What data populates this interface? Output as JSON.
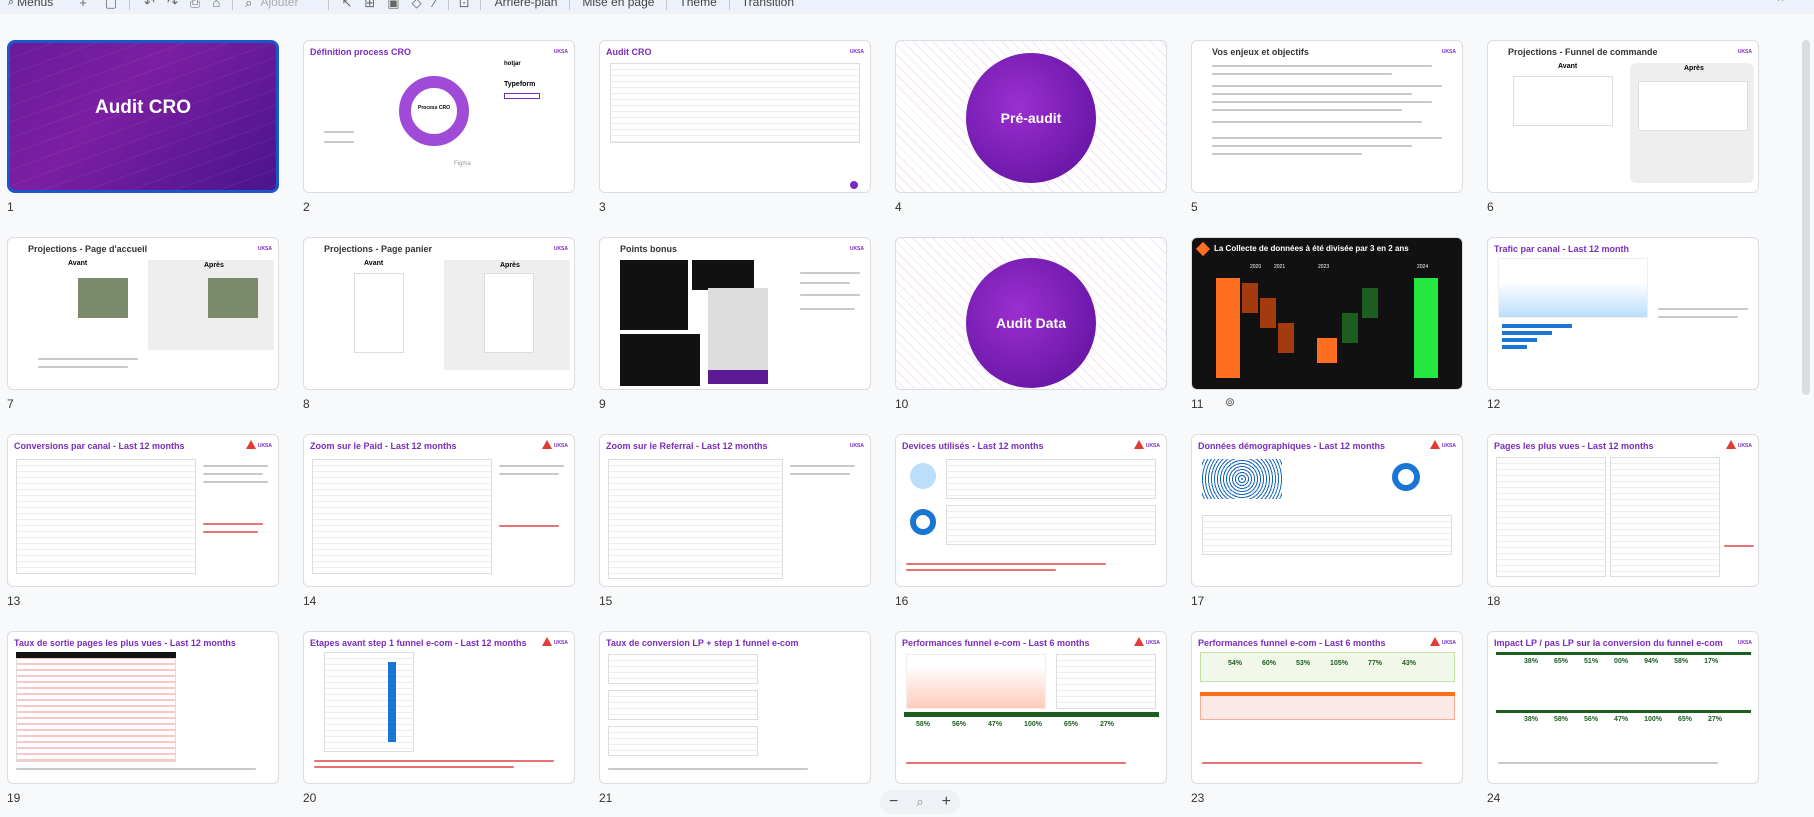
{
  "toolbar": {
    "menus_label": "Menus",
    "ajouter_label": "Ajouter",
    "arriere_plan_label": "Arrière-plan",
    "mise_en_page_label": "Mise en page",
    "theme_label": "Thème",
    "transition_label": "Transition"
  },
  "slides": [
    {
      "num": "1",
      "title": "Audit CRO"
    },
    {
      "num": "2",
      "title": "Définition process CRO",
      "center": "Process CRO"
    },
    {
      "num": "3",
      "title": "Audit CRO"
    },
    {
      "num": "4",
      "title": "Pré-audit"
    },
    {
      "num": "5",
      "title": "Vos enjeux et objectifs"
    },
    {
      "num": "6",
      "title": "Projections - Funnel de commande",
      "left": "Avant",
      "right": "Après"
    },
    {
      "num": "7",
      "title": "Projections - Page d'accueil",
      "left": "Avant",
      "right": "Après"
    },
    {
      "num": "8",
      "title": "Projections - Page panier",
      "left": "Avant",
      "right": "Après"
    },
    {
      "num": "9",
      "title": "Points bonus"
    },
    {
      "num": "10",
      "title": "Audit Data"
    },
    {
      "num": "11",
      "title": "La Collecte de données à été divisée par 3 en 2 ans",
      "years": [
        "2020",
        "2021",
        "2023",
        "2024"
      ]
    },
    {
      "num": "12",
      "title": "Trafic par canal - Last 12 month"
    },
    {
      "num": "13",
      "title": "Conversions par canal - Last 12 months"
    },
    {
      "num": "14",
      "title": "Zoom sur le Paid - Last 12 months"
    },
    {
      "num": "15",
      "title": "Zoom sur le Referral - Last 12 months"
    },
    {
      "num": "16",
      "title": "Devices utilisés - Last 12 months"
    },
    {
      "num": "17",
      "title": "Données démographiques - Last 12 months"
    },
    {
      "num": "18",
      "title": "Pages les plus vues - Last 12 months"
    },
    {
      "num": "19",
      "title": "Taux de sortie pages les plus vues - Last 12 months"
    },
    {
      "num": "20",
      "title": "Etapes avant step 1 funnel e-com - Last 12 months"
    },
    {
      "num": "21",
      "title": "Taux de conversion LP + step 1 funnel e-com"
    },
    {
      "num": "22",
      "title": "Performances funnel e-com - Last 6 months",
      "pcts": [
        "58%",
        "56%",
        "47%",
        "100%",
        "65%",
        "27%"
      ]
    },
    {
      "num": "23",
      "title": "Performances funnel e-com - Last 6 months",
      "pcts": [
        "54%",
        "60%",
        "53%",
        "105%",
        "77%",
        "43%"
      ]
    },
    {
      "num": "24",
      "title": "Impact LP / pas LP sur la conversion du funnel e-com",
      "pcts1": [
        "38%",
        "65%",
        "51%",
        "00%",
        "94%",
        "58%",
        "17%"
      ],
      "pcts2": [
        "38%",
        "58%",
        "56%",
        "47%",
        "100%",
        "65%",
        "27%"
      ]
    }
  ],
  "colors": {
    "accent": "#7b2cbf",
    "selected_border": "#1a57c9",
    "warning": "#e53935"
  }
}
